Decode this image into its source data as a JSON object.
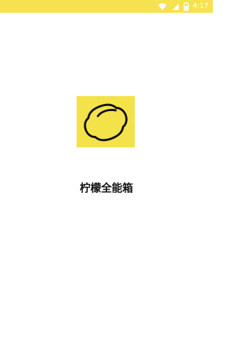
{
  "status_bar": {
    "time": "4:17",
    "background_color": "#f6e250",
    "icons": [
      "wifi-icon",
      "signal-icon",
      "battery-icon"
    ]
  },
  "splash": {
    "app_name": "柠檬全能箱",
    "icon": "lemon-icon",
    "icon_background_color": "#f4e24a"
  }
}
